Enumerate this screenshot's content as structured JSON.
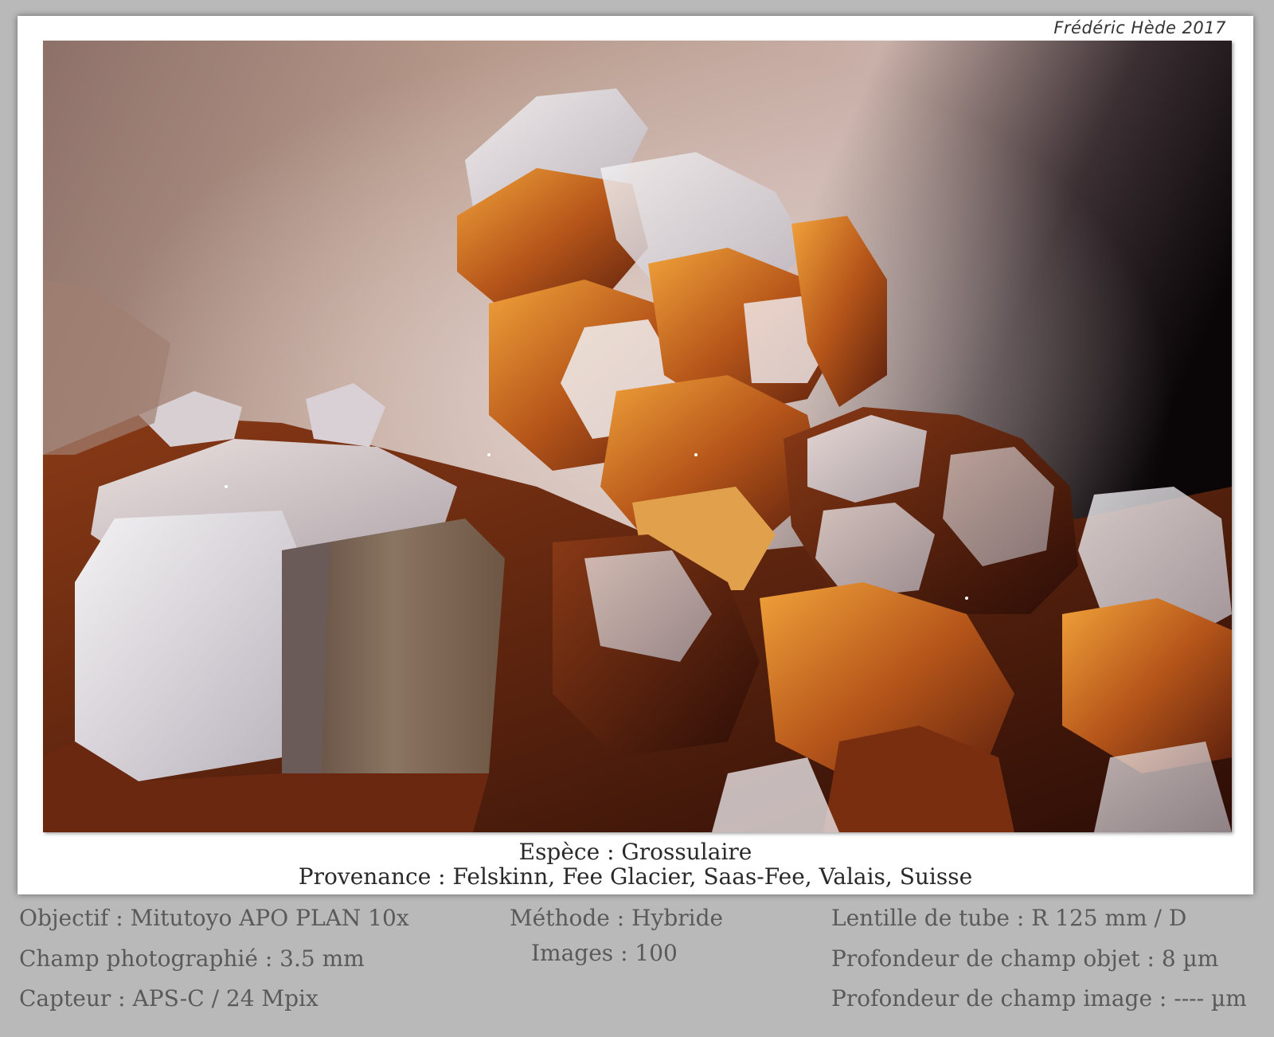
{
  "credit": "Frédéric Hède 2017",
  "caption": {
    "species": "Espèce : Grossulaire",
    "origin": "Provenance : Felskinn, Fee Glacier, Saas-Fee, Valais, Suisse"
  },
  "specs": {
    "objective": "Objectif : Mitutoyo APO PLAN 10x",
    "field": "Champ photographié : 3.5 mm",
    "sensor": "Capteur : APS-C / 24 Mpix",
    "method": "Méthode : Hybride",
    "images": "Images : 100",
    "tube_lens": "Lentille de tube : R 125 mm / D",
    "object_dof": "Profondeur de champ objet : 8 µm",
    "image_dof": "Profondeur de champ image : ---- µm"
  }
}
